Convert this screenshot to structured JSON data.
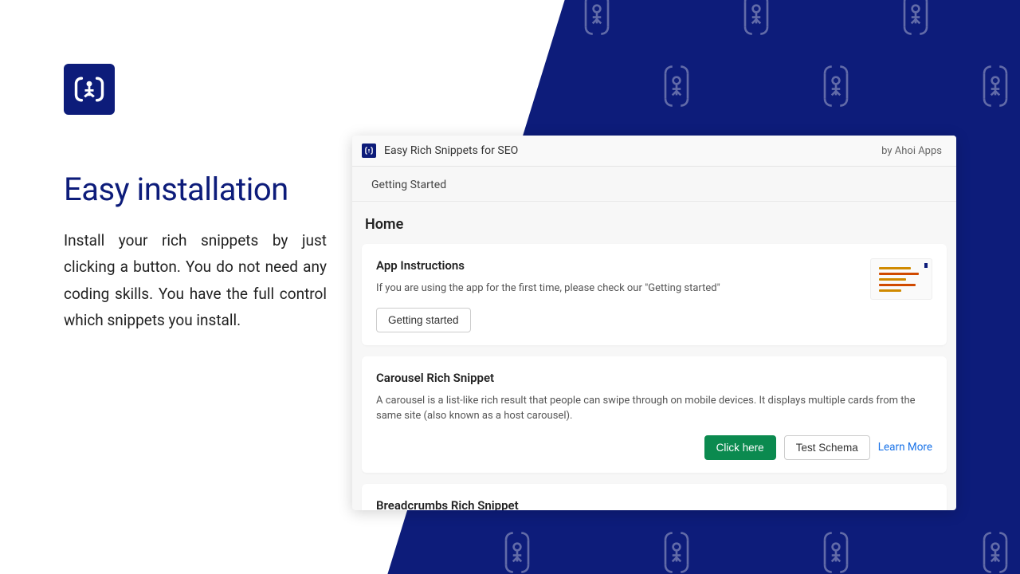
{
  "left": {
    "headline": "Easy installation",
    "description": "Install your rich snippets by just clicking a button. You do not need any coding skills. You have the full control which snippets you install."
  },
  "app": {
    "title": "Easy Rich Snippets for SEO",
    "by": "by Ahoi Apps",
    "tab": "Getting Started",
    "page_title": "Home",
    "cards": {
      "instructions": {
        "title": "App Instructions",
        "desc": "If you are using the app for the first time, please check our \"Getting started\"",
        "button": "Getting started"
      },
      "carousel": {
        "title": "Carousel Rich Snippet",
        "desc": "A carousel is a list-like rich result that people can swipe through on mobile devices. It displays multiple cards from the same site (also known as a host carousel).",
        "click_here": "Click here",
        "test_schema": "Test Schema",
        "learn_more": "Learn More"
      },
      "breadcrumbs": {
        "title": "Breadcrumbs Rich Snippet"
      }
    }
  }
}
